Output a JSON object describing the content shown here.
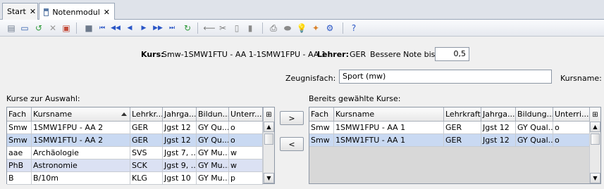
{
  "tabs": [
    {
      "label": "Start",
      "close": "✕"
    },
    {
      "label": "Notenmodul",
      "close": "✕"
    }
  ],
  "toolbar": {
    "icons": [
      "edit-icon",
      "save-icon",
      "undo-icon",
      "delete-icon",
      "cancel-icon",
      "folder-icon",
      "first-icon",
      "prev-page-icon",
      "prev-icon",
      "next-icon",
      "next-page-icon",
      "last-icon",
      "refresh-icon",
      "back-arrow-icon",
      "cut-icon",
      "copy-icon",
      "paste-icon",
      "print-icon",
      "preview-icon",
      "bulb-icon",
      "wizard-icon",
      "settings-icon",
      "help-icon"
    ],
    "glyphs": [
      "▤",
      "▭",
      "↺",
      "✕",
      "▣",
      "■",
      "⏮",
      "◀◀",
      "◀",
      "▶",
      "▶▶",
      "⏭",
      "↻",
      "⟵",
      "✂",
      "▯",
      "▮",
      "⎙",
      "⬬",
      "💡",
      "✦",
      "⚙",
      "?"
    ],
    "colors": [
      "#6d7a8c",
      "#2f5fae",
      "#2e9a3a",
      "#9a9a9a",
      "#c44b3a",
      "#6d7a8c",
      "#2a56c6",
      "#2a56c6",
      "#2a56c6",
      "#2a56c6",
      "#2a56c6",
      "#2a56c6",
      "#2e9a3a",
      "#7a7a7a",
      "#7a7a7a",
      "#8a8a8a",
      "#8a8a8a",
      "#555",
      "#8a8a8a",
      "#e6b800",
      "#d9822b",
      "#2a56c6",
      "#2a56c6"
    ]
  },
  "info": {
    "kurs_label": "Kurs:",
    "kurs_value": "Smw-1SMW1FTU - AA 1-1SMW1FPU - AA 1",
    "lehrer_label": "Lehrer:",
    "lehrer_value": "GER",
    "note_label": "Bessere Note bis:",
    "note_value": "0,5",
    "zeugnisfach_label": "Zeugnisfach:",
    "zeugnisfach_value": "Sport (mw)",
    "kursname_label": "Kursname:"
  },
  "left_table": {
    "title": "Kurse zur Auswahl:",
    "columns": [
      "Fach",
      "Kursname",
      "Lehrkr...",
      "Jahrga...",
      "Bildun...",
      "Unterr..."
    ],
    "rows": [
      {
        "cells": [
          "Smw",
          "1SMW1FPU - AA 2",
          "GER",
          "Jgst 12",
          "GY Qu...",
          "o"
        ],
        "style": "white"
      },
      {
        "cells": [
          "Smw",
          "1SMW1FTU - AA 2",
          "GER",
          "Jgst 12",
          "GY Qu...",
          "o"
        ],
        "style": "sel"
      },
      {
        "cells": [
          "aae",
          "Archäologie",
          "SVS",
          "Jgst 7, ...",
          "GY Mu...",
          "w"
        ],
        "style": "white"
      },
      {
        "cells": [
          "PhB",
          "Astronomie",
          "SCK",
          "Jgst 9, ...",
          "GY Mu...",
          "w"
        ],
        "style": "lav"
      },
      {
        "cells": [
          "B",
          "B/10m",
          "KLG",
          "Jgst 10",
          "GY Mu...",
          "p"
        ],
        "style": "white"
      }
    ]
  },
  "right_table": {
    "title": "Bereits gewählte Kurse:",
    "columns": [
      "Fach",
      "Kursname",
      "Lehrkraft",
      "Jahrga...",
      "Bildung...",
      "Unterri..."
    ],
    "rows": [
      {
        "cells": [
          "Smw",
          "1SMW1FPU - AA 1",
          "GER",
          "Jgst 12",
          "GY Qual...",
          "o"
        ],
        "style": "white"
      },
      {
        "cells": [
          "Smw",
          "1SMW1FTU - AA 1",
          "GER",
          "Jgst 12",
          "GY Qual...",
          "o"
        ],
        "style": "sel"
      }
    ]
  },
  "buttons": {
    "add": ">",
    "remove": "<"
  }
}
